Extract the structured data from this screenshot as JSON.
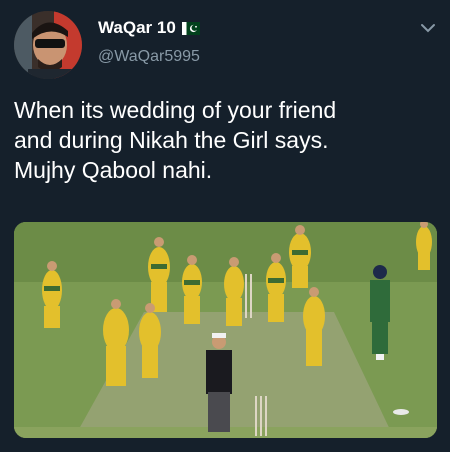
{
  "author": {
    "display_name": "WaQar 10",
    "handle": "@WaQar5995",
    "flag_icon": "pakistan-flag-icon",
    "avatar_icon": "avatar"
  },
  "menu": {
    "icon": "chevron-down-icon"
  },
  "tweet": {
    "lines": [
      "When its wedding of your friend",
      "and during Nikah the Girl says.",
      "Mujhy Qabool nahi."
    ]
  },
  "media": {
    "kind": "photo",
    "subject": "cricket-celebration-photo"
  },
  "colors": {
    "background": "#15202b",
    "text": "#ffffff",
    "secondary_text": "#8899a6",
    "grass": "#6f9449",
    "jersey_yellow": "#e7c42d",
    "jersey_green": "#3d6b32"
  }
}
